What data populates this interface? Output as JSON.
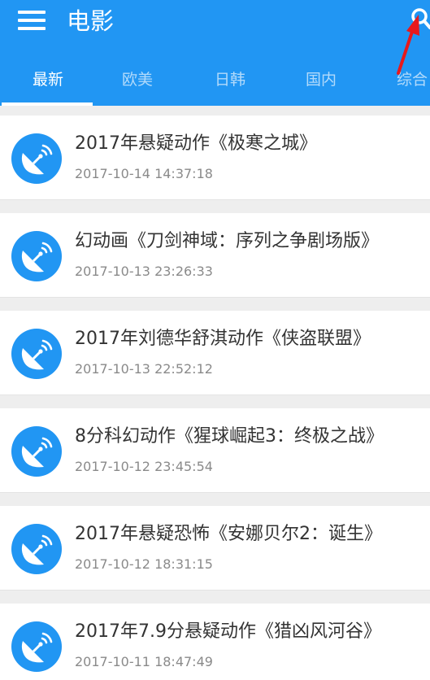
{
  "header": {
    "title": "电影",
    "background": "#2196f3"
  },
  "tabs": [
    {
      "label": "最新",
      "active": true
    },
    {
      "label": "欧美",
      "active": false
    },
    {
      "label": "日韩",
      "active": false
    },
    {
      "label": "国内",
      "active": false
    },
    {
      "label": "综合",
      "active": false
    }
  ],
  "list": [
    {
      "title": "2017年悬疑动作《极寒之城》",
      "time": "2017-10-14 14:37:18"
    },
    {
      "title": "幻动画《刀剑神域：序列之争剧场版》",
      "time": "2017-10-13 23:26:33"
    },
    {
      "title": "2017年刘德华舒淇动作《侠盗联盟》",
      "time": "2017-10-13 22:52:12"
    },
    {
      "title": "8分科幻动作《猩球崛起3：终极之战》",
      "time": "2017-10-12 23:45:54"
    },
    {
      "title": "2017年悬疑恐怖《安娜贝尔2：诞生》",
      "time": "2017-10-12 18:31:15"
    },
    {
      "title": "2017年7.9分悬疑动作《猎凶风河谷》",
      "time": "2017-10-11 18:47:49"
    }
  ],
  "icons": {
    "menu": "menu-icon",
    "search": "search-icon",
    "item": "satellite-dish-icon"
  }
}
